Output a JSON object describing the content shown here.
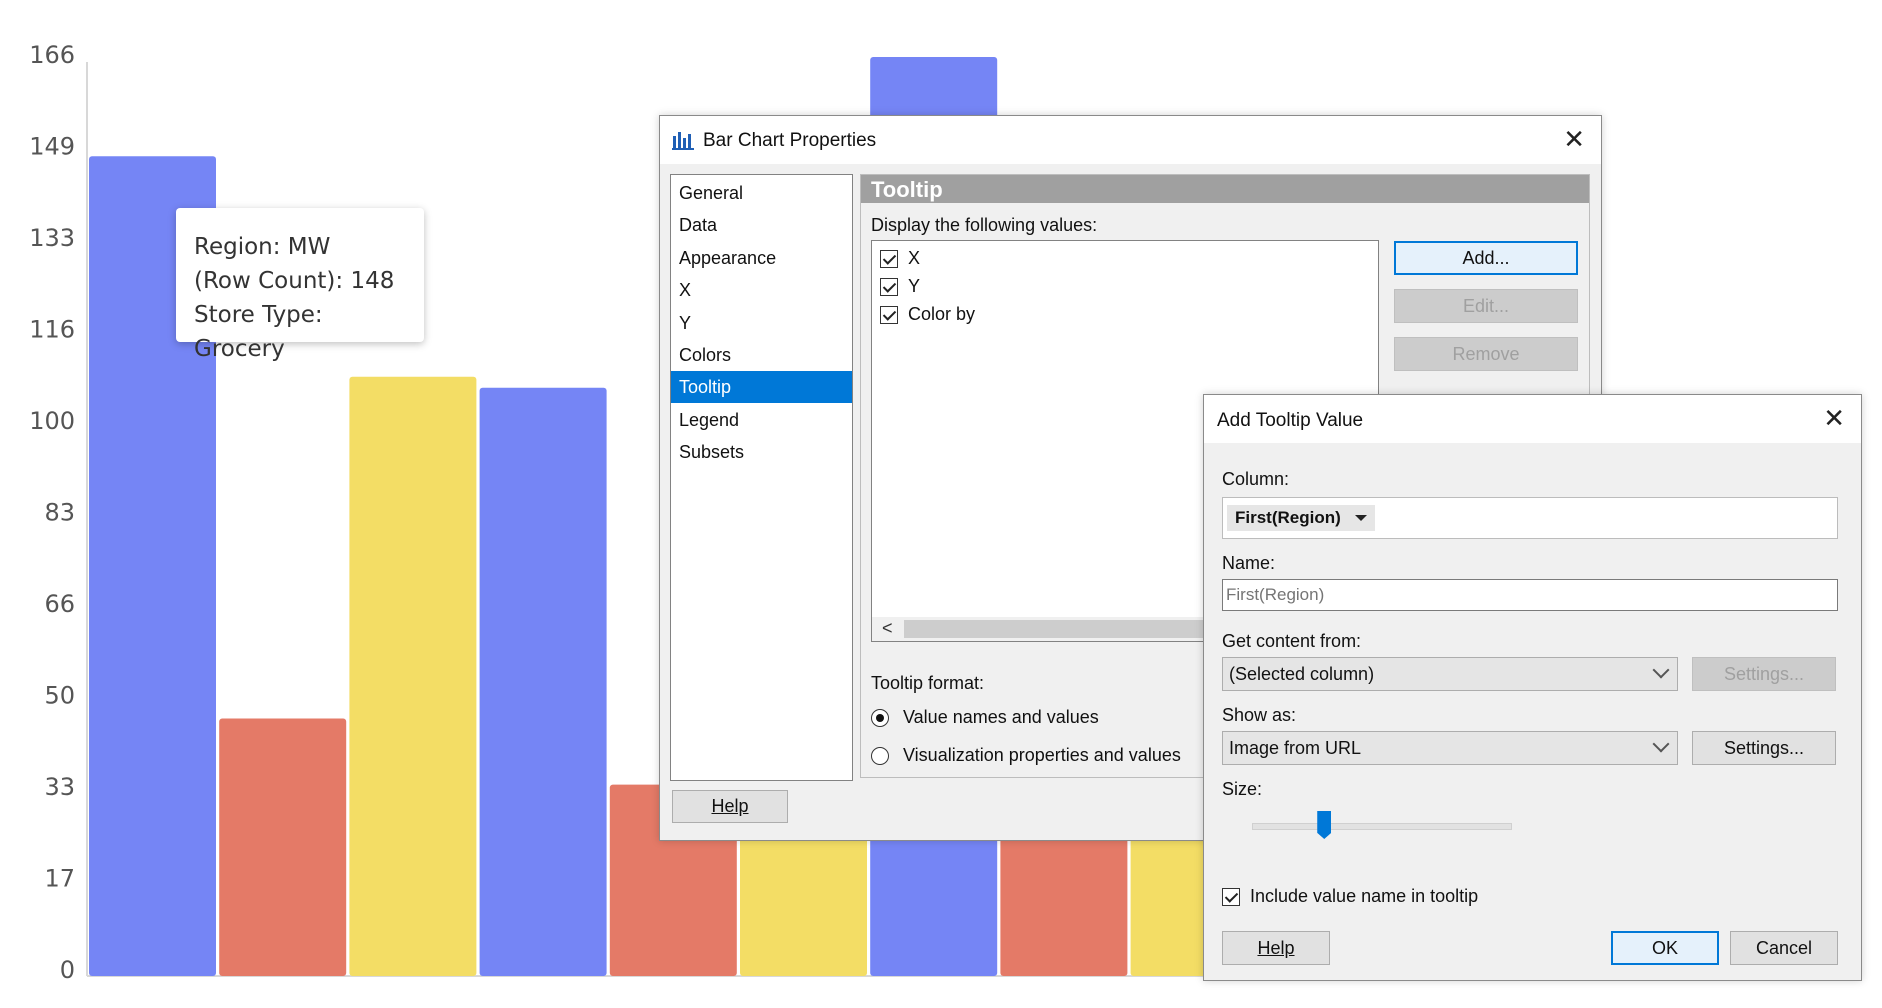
{
  "chart_data": {
    "type": "bar",
    "y_ticks": [
      "166",
      "149",
      "133",
      "116",
      "100",
      "83",
      "66",
      "50",
      "33",
      "17",
      "0"
    ],
    "ylim": [
      0,
      166
    ],
    "colors": {
      "blue": "#7585f5",
      "red": "#e47a67",
      "yellow": "#f3dd65"
    },
    "bars": [
      {
        "value": 148,
        "color": "blue"
      },
      {
        "value": 46,
        "color": "red"
      },
      {
        "value": 108,
        "color": "yellow"
      },
      {
        "value": 106,
        "color": "blue"
      },
      {
        "value": 34,
        "color": "red"
      },
      {
        "value": 30,
        "color": "yellow"
      },
      {
        "value": 166,
        "color": "blue"
      },
      {
        "value": 30,
        "color": "red"
      },
      {
        "value": 30,
        "color": "yellow"
      }
    ]
  },
  "tooltip": {
    "line1": "Region: MW",
    "line2": "(Row Count): 148",
    "line3": "Store Type: Grocery"
  },
  "bar_chart_properties": {
    "title": "Bar Chart Properties",
    "nav_items": [
      "General",
      "Data",
      "Appearance",
      "X",
      "Y",
      "Colors",
      "Tooltip",
      "Legend",
      "Subsets"
    ],
    "selected_nav": "Tooltip",
    "section_header": "Tooltip",
    "display_label": "Display the following values:",
    "values": [
      {
        "label": "X",
        "checked": true
      },
      {
        "label": "Y",
        "checked": true
      },
      {
        "label": "Color by",
        "checked": true
      }
    ],
    "add_label": "Add...",
    "edit_label": "Edit...",
    "remove_label": "Remove",
    "scroll_left": "<",
    "format_label": "Tooltip format:",
    "format_options": [
      "Value names and values",
      "Visualization properties and values"
    ],
    "format_selected": 0,
    "help_label": "Help"
  },
  "add_tooltip_value": {
    "title": "Add Tooltip Value",
    "column_label": "Column:",
    "column_value": "First(Region)",
    "name_label": "Name:",
    "name_placeholder": "First(Region)",
    "content_label": "Get content from:",
    "content_value": "(Selected column)",
    "content_settings_label": "Settings...",
    "show_as_label": "Show as:",
    "show_as_value": "Image from URL",
    "show_as_settings_label": "Settings...",
    "size_label": "Size:",
    "size_level": 0.28,
    "include_label": "Include value name in tooltip",
    "include_checked": true,
    "help_label": "Help",
    "ok_label": "OK",
    "cancel_label": "Cancel"
  }
}
